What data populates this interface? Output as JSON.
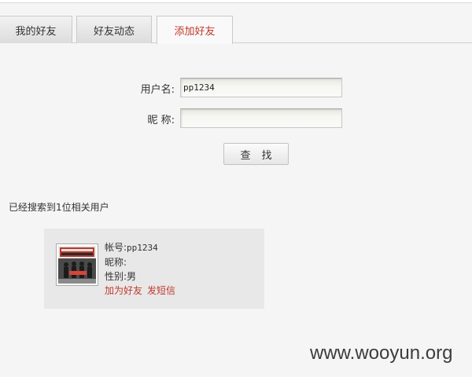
{
  "tabs": [
    {
      "label": "我的好友"
    },
    {
      "label": "好友动态"
    },
    {
      "label": "添加好友",
      "active": true
    }
  ],
  "form": {
    "username_label": "用户名:",
    "username_value": "pp1234",
    "nickname_label": "昵 称:",
    "nickname_value": "",
    "search_button": "查找"
  },
  "results": {
    "summary": "已经搜索到1位相关用户",
    "users": [
      {
        "account_label": "帐号:",
        "account_value": "pp1234",
        "nickname_label": "昵称:",
        "nickname_value": "",
        "gender_label": "性别:",
        "gender_value": "男",
        "add_friend_link": "加为好友",
        "message_link": "发短信"
      }
    ]
  },
  "watermark": "www.wooyun.org",
  "colors": {
    "accent": "#c0392b",
    "card_bg": "#e8e8e8",
    "page_bg": "#f5f5f5"
  },
  "icons": {
    "avatar": "user-avatar-image"
  }
}
